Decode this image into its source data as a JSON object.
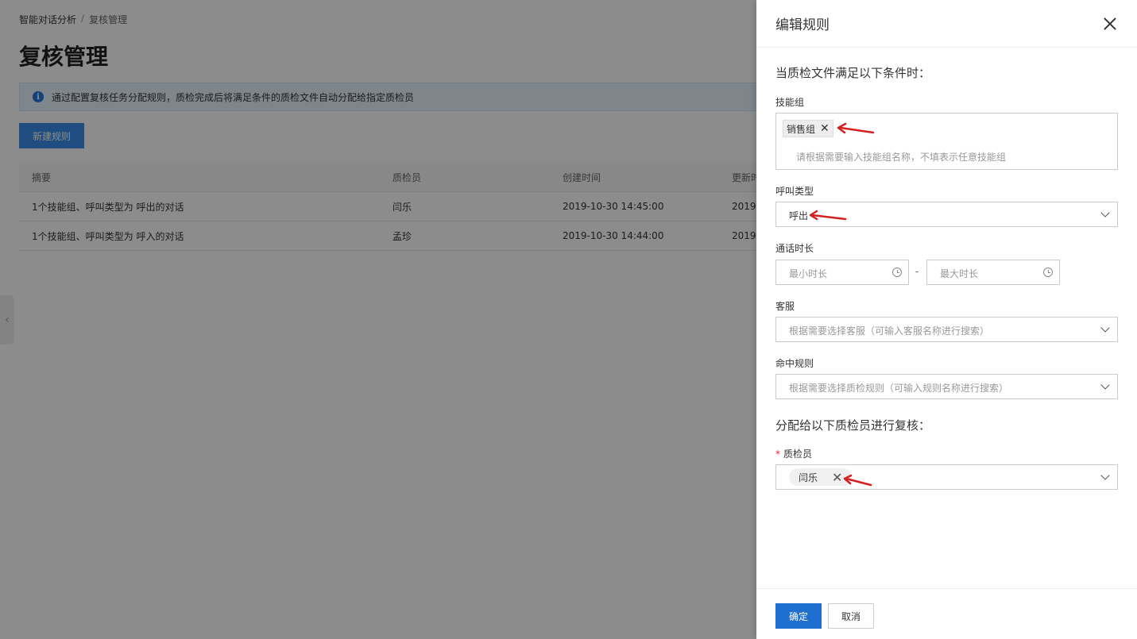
{
  "breadcrumb": {
    "root": "智能对话分析",
    "separator": "/",
    "current": "复核管理"
  },
  "page": {
    "title": "复核管理",
    "notice": "通过配置复核任务分配规则，质检完成后将满足条件的质检文件自动分配给指定质检员",
    "new_rule_button": "新建规则"
  },
  "table": {
    "headers": [
      "摘要",
      "质检员",
      "创建时间",
      "更新时"
    ],
    "rows": [
      [
        "1个技能组、呼叫类型为 呼出的对话",
        "闫乐",
        "2019-10-30 14:45:00",
        "2019-"
      ],
      [
        "1个技能组、呼叫类型为 呼入的对话",
        "孟珍",
        "2019-10-30 14:44:00",
        "2019-"
      ]
    ]
  },
  "drawer": {
    "title": "编辑规则",
    "conditions_title": "当质检文件满足以下条件时：",
    "skill_group": {
      "label": "技能组",
      "tag": "销售组",
      "placeholder": "请根据需要输入技能组名称，不填表示任意技能组"
    },
    "call_type": {
      "label": "呼叫类型",
      "value": "呼出"
    },
    "duration": {
      "label": "通话时长",
      "min_placeholder": "最小时长",
      "max_placeholder": "最大时长",
      "separator": "-"
    },
    "agent": {
      "label": "客服",
      "placeholder": "根据需要选择客服（可输入客服名称进行搜索）"
    },
    "hit_rule": {
      "label": "命中规则",
      "placeholder": "根据需要选择质检规则（可输入规则名称进行搜索）"
    },
    "assign_title": "分配给以下质检员进行复核：",
    "inspector": {
      "required_mark": "*",
      "label": "质检员",
      "tag": "闫乐"
    },
    "ok_button": "确定",
    "cancel_button": "取消"
  },
  "colors": {
    "primary": "#1f6fd1",
    "annotation_arrow": "#d42020"
  }
}
